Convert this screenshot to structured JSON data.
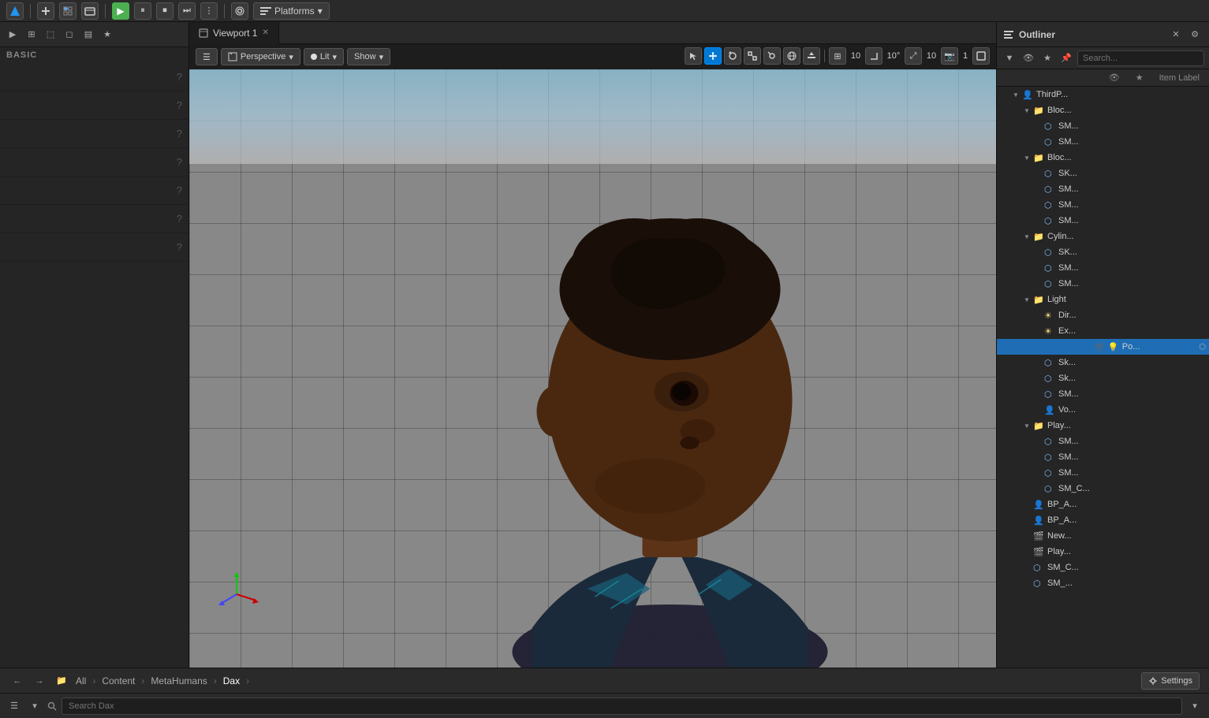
{
  "topToolbar": {
    "platformsLabel": "Platforms",
    "playBtnSymbol": "▶",
    "pauseBtnSymbol": "⏸",
    "stopBtnSymbol": "⏹"
  },
  "viewport": {
    "tabLabel": "Viewport 1",
    "perspectiveLabel": "Perspective",
    "litLabel": "Lit",
    "showLabel": "Show",
    "gridSnapValue": "10",
    "rotSnapValue": "10°",
    "scaleSnapValue": "10",
    "camSpeedValue": "1"
  },
  "leftPanel": {
    "sectionLabel": "BASIC"
  },
  "outliner": {
    "title": "Outliner",
    "searchPlaceholder": "Search...",
    "columnLabel": "Item Label",
    "items": [
      {
        "indent": 1,
        "type": "actor",
        "label": "ThirdP...",
        "arrow": "▼"
      },
      {
        "indent": 2,
        "type": "folder",
        "label": "Bloc...",
        "arrow": "▼"
      },
      {
        "indent": 3,
        "type": "mesh",
        "label": "SM..."
      },
      {
        "indent": 3,
        "type": "mesh",
        "label": "SM..."
      },
      {
        "indent": 2,
        "type": "folder",
        "label": "Bloc...",
        "arrow": "▼"
      },
      {
        "indent": 3,
        "type": "mesh",
        "label": "SK..."
      },
      {
        "indent": 3,
        "type": "mesh",
        "label": "SM..."
      },
      {
        "indent": 3,
        "type": "mesh",
        "label": "SM..."
      },
      {
        "indent": 3,
        "type": "mesh",
        "label": "SM..."
      },
      {
        "indent": 2,
        "type": "folder",
        "label": "Cylin...",
        "arrow": "▼"
      },
      {
        "indent": 3,
        "type": "mesh",
        "label": "SK..."
      },
      {
        "indent": 3,
        "type": "mesh",
        "label": "SM..."
      },
      {
        "indent": 3,
        "type": "mesh",
        "label": "SM..."
      },
      {
        "indent": 2,
        "type": "folder",
        "label": "Light",
        "arrow": "▼",
        "isLight": true
      },
      {
        "indent": 3,
        "type": "light",
        "label": "Dir..."
      },
      {
        "indent": 3,
        "type": "light",
        "label": "Ex..."
      },
      {
        "indent": 3,
        "type": "light",
        "label": "Po...",
        "selected": true
      },
      {
        "indent": 3,
        "type": "mesh",
        "label": "Sk..."
      },
      {
        "indent": 3,
        "type": "mesh",
        "label": "Sk..."
      },
      {
        "indent": 3,
        "type": "mesh",
        "label": "SM..."
      },
      {
        "indent": 3,
        "type": "actor",
        "label": "Vo..."
      },
      {
        "indent": 2,
        "type": "folder",
        "label": "Play...",
        "arrow": "▼"
      },
      {
        "indent": 3,
        "type": "mesh",
        "label": "SM..."
      },
      {
        "indent": 3,
        "type": "mesh",
        "label": "SM..."
      },
      {
        "indent": 3,
        "type": "mesh",
        "label": "SM..."
      },
      {
        "indent": 3,
        "type": "mesh",
        "label": "SM_C..."
      },
      {
        "indent": 2,
        "type": "actor",
        "label": "BP_A..."
      },
      {
        "indent": 2,
        "type": "actor",
        "label": "BP_A..."
      },
      {
        "indent": 2,
        "type": "actor",
        "label": "New..."
      },
      {
        "indent": 2,
        "type": "actor",
        "label": "Play..."
      },
      {
        "indent": 2,
        "type": "mesh",
        "label": "SM_C..."
      },
      {
        "indent": 2,
        "type": "mesh",
        "label": "SM_..."
      }
    ]
  },
  "bottomBar": {
    "settingsLabel": "Settings",
    "breadcrumb": [
      "All",
      "Content",
      "MetaHumans",
      "Dax"
    ],
    "searchPlaceholder": "Search Dax"
  },
  "icons": {
    "hamburger": "☰",
    "chevronDown": "▾",
    "chevronRight": "▸",
    "close": "✕",
    "grid": "⊞",
    "eye": "👁",
    "star": "★",
    "settings": "⚙",
    "filter": "⚗",
    "search": "🔍",
    "folder": "📁",
    "mesh": "⬡",
    "light": "💡",
    "actor": "👤",
    "camera": "📷"
  }
}
